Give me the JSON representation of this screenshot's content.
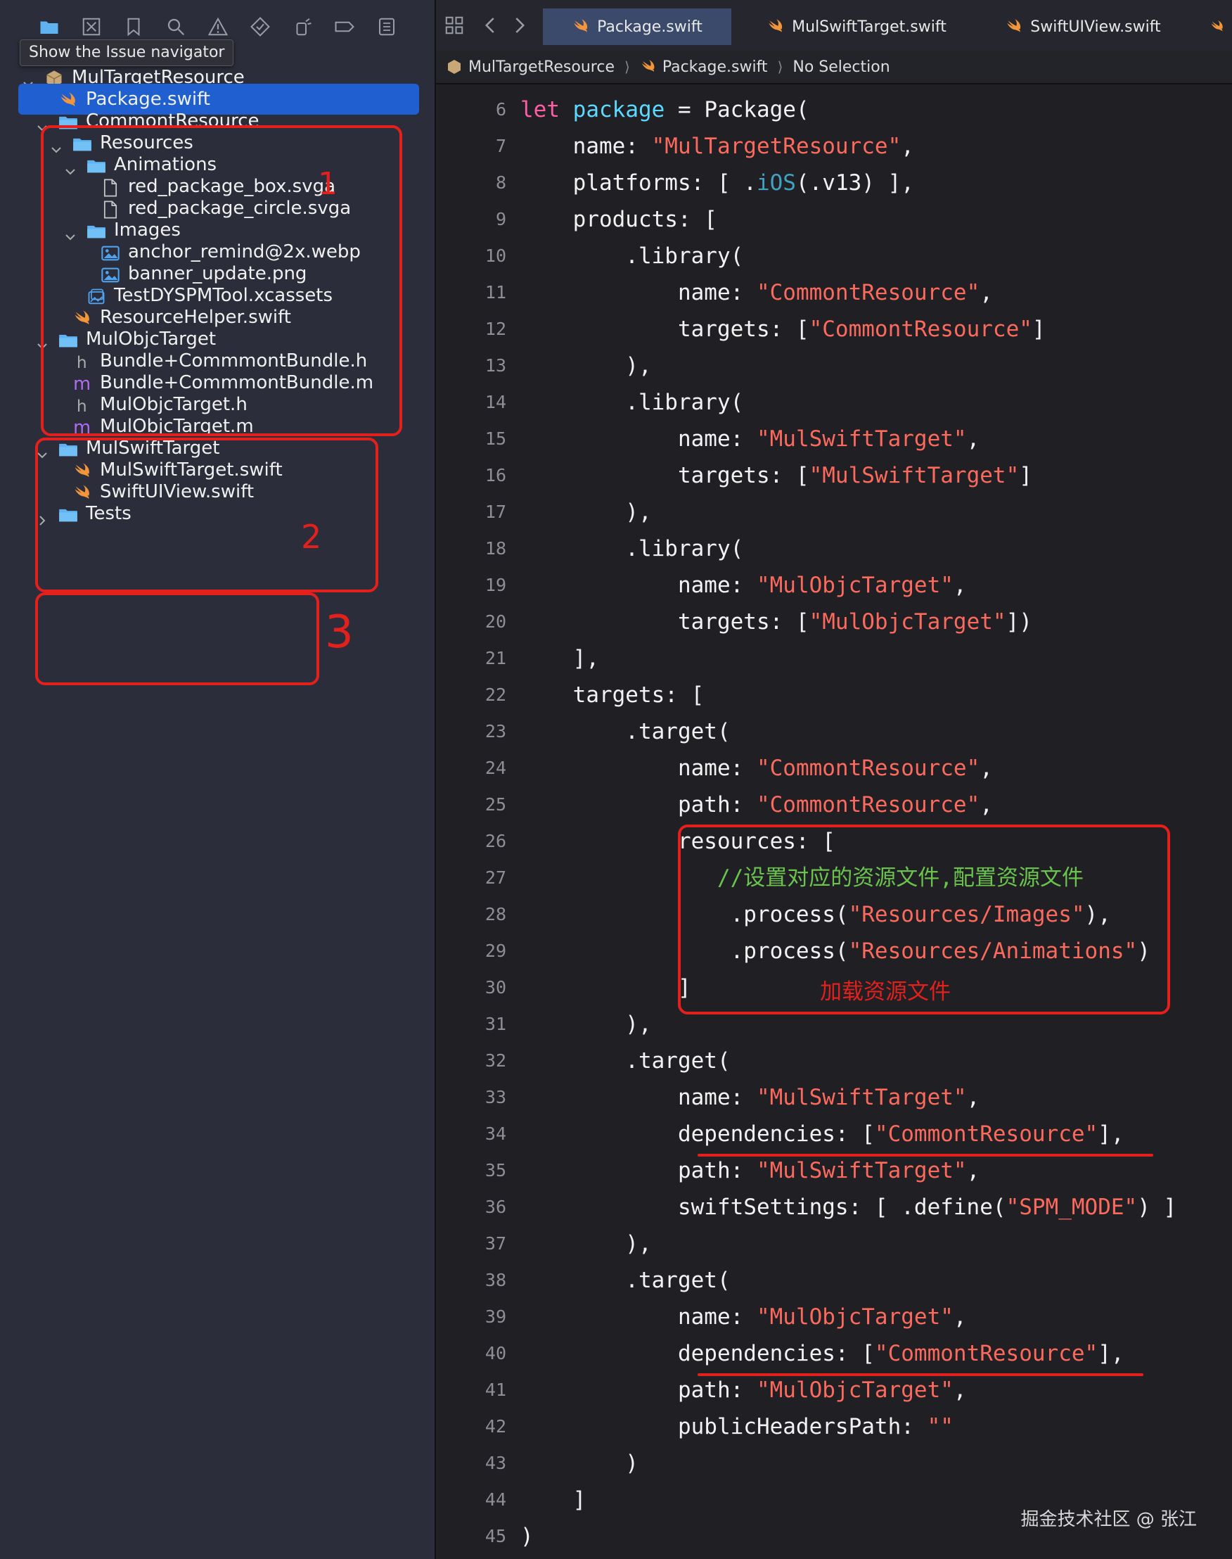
{
  "navigator": {
    "tooltip": "Show the Issue navigator",
    "toolbar_icons": [
      "folder-icon",
      "source-control-icon",
      "bookmark-icon",
      "search-icon",
      "warning-icon",
      "test-icon",
      "debug-icon",
      "breakpoint-icon",
      "report-icon"
    ],
    "tree": [
      {
        "label": "MulTargetResource",
        "kind": "package",
        "depth": 0,
        "disclosure": "open"
      },
      {
        "label": "Package.swift",
        "kind": "swift",
        "depth": 1,
        "selected": true
      },
      {
        "label": "CommontResource",
        "kind": "folder",
        "depth": 1,
        "disclosure": "open"
      },
      {
        "label": "Resources",
        "kind": "folder",
        "depth": 2,
        "disclosure": "open"
      },
      {
        "label": "Animations",
        "kind": "folder",
        "depth": 3,
        "disclosure": "open"
      },
      {
        "label": "red_package_box.svga",
        "kind": "file",
        "depth": 4
      },
      {
        "label": "red_package_circle.svga",
        "kind": "file",
        "depth": 4
      },
      {
        "label": "Images",
        "kind": "folder",
        "depth": 3,
        "disclosure": "open"
      },
      {
        "label": "anchor_remind@2x.webp",
        "kind": "image",
        "depth": 4
      },
      {
        "label": "banner_update.png",
        "kind": "image",
        "depth": 4
      },
      {
        "label": "TestDYSPMTool.xcassets",
        "kind": "assets",
        "depth": 3
      },
      {
        "label": "ResourceHelper.swift",
        "kind": "swift",
        "depth": 2
      },
      {
        "label": "MulObjcTarget",
        "kind": "folder",
        "depth": 1,
        "disclosure": "open"
      },
      {
        "label": "Bundle+CommmontBundle.h",
        "kind": "h",
        "depth": 2
      },
      {
        "label": "Bundle+CommmontBundle.m",
        "kind": "m",
        "depth": 2
      },
      {
        "label": "MulObjcTarget.h",
        "kind": "h",
        "depth": 2
      },
      {
        "label": "MulObjcTarget.m",
        "kind": "m",
        "depth": 2
      },
      {
        "label": "MulSwiftTarget",
        "kind": "folder",
        "depth": 1,
        "disclosure": "open"
      },
      {
        "label": "MulSwiftTarget.swift",
        "kind": "swift",
        "depth": 2
      },
      {
        "label": "SwiftUIView.swift",
        "kind": "swift",
        "depth": 2
      },
      {
        "label": "Tests",
        "kind": "folder",
        "depth": 1,
        "disclosure": "closed"
      }
    ],
    "annotations": [
      "1",
      "2",
      "3"
    ]
  },
  "editor": {
    "tabs": [
      {
        "label": "Package.swift",
        "active": true
      },
      {
        "label": "MulSwiftTarget.swift",
        "active": false
      },
      {
        "label": "SwiftUIView.swift",
        "active": false
      }
    ],
    "breadcrumb": [
      "MulTargetResource",
      "Package.swift",
      "No Selection"
    ],
    "lines": [
      {
        "n": "6",
        "tokens": [
          [
            "kw",
            "let"
          ],
          [
            "p",
            " "
          ],
          [
            "ty",
            "package"
          ],
          [
            "p",
            " = Package("
          ]
        ]
      },
      {
        "n": "7",
        "tokens": [
          [
            "p",
            "    name: "
          ],
          [
            "st",
            "\"MulTargetResource\""
          ],
          [
            "p",
            ","
          ]
        ]
      },
      {
        "n": "8",
        "tokens": [
          [
            "p",
            "    platforms: [ ."
          ],
          [
            "fn",
            "iOS"
          ],
          [
            "p",
            "(.v13) ],"
          ]
        ]
      },
      {
        "n": "9",
        "tokens": [
          [
            "p",
            "    products: ["
          ]
        ]
      },
      {
        "n": "10",
        "tokens": [
          [
            "p",
            "        .library("
          ]
        ]
      },
      {
        "n": "11",
        "tokens": [
          [
            "p",
            "            name: "
          ],
          [
            "st",
            "\"CommontResource\""
          ],
          [
            "p",
            ","
          ]
        ]
      },
      {
        "n": "12",
        "tokens": [
          [
            "p",
            "            targets: ["
          ],
          [
            "st",
            "\"CommontResource\""
          ],
          [
            "p",
            "]"
          ]
        ]
      },
      {
        "n": "13",
        "tokens": [
          [
            "p",
            "        ),"
          ]
        ]
      },
      {
        "n": "14",
        "tokens": [
          [
            "p",
            "        .library("
          ]
        ]
      },
      {
        "n": "15",
        "tokens": [
          [
            "p",
            "            name: "
          ],
          [
            "st",
            "\"MulSwiftTarget\""
          ],
          [
            "p",
            ","
          ]
        ]
      },
      {
        "n": "16",
        "tokens": [
          [
            "p",
            "            targets: ["
          ],
          [
            "st",
            "\"MulSwiftTarget\""
          ],
          [
            "p",
            "]"
          ]
        ]
      },
      {
        "n": "17",
        "tokens": [
          [
            "p",
            "        ),"
          ]
        ]
      },
      {
        "n": "18",
        "tokens": [
          [
            "p",
            "        .library("
          ]
        ]
      },
      {
        "n": "19",
        "tokens": [
          [
            "p",
            "            name: "
          ],
          [
            "st",
            "\"MulObjcTarget\""
          ],
          [
            "p",
            ","
          ]
        ]
      },
      {
        "n": "20",
        "tokens": [
          [
            "p",
            "            targets: ["
          ],
          [
            "st",
            "\"MulObjcTarget\""
          ],
          [
            "p",
            "])"
          ]
        ]
      },
      {
        "n": "21",
        "tokens": [
          [
            "p",
            "    ],"
          ]
        ]
      },
      {
        "n": "22",
        "tokens": [
          [
            "p",
            "    targets: ["
          ]
        ]
      },
      {
        "n": "23",
        "tokens": [
          [
            "p",
            "        .target("
          ]
        ]
      },
      {
        "n": "24",
        "tokens": [
          [
            "p",
            "            name: "
          ],
          [
            "st",
            "\"CommontResource\""
          ],
          [
            "p",
            ","
          ]
        ]
      },
      {
        "n": "25",
        "tokens": [
          [
            "p",
            "            path: "
          ],
          [
            "st",
            "\"CommontResource\""
          ],
          [
            "p",
            ","
          ]
        ]
      },
      {
        "n": "26",
        "tokens": [
          [
            "p",
            "            resources: ["
          ]
        ]
      },
      {
        "n": "27",
        "tokens": [
          [
            "p",
            "               "
          ],
          [
            "cm",
            "//设置对应的资源文件,配置资源文件"
          ]
        ]
      },
      {
        "n": "28",
        "tokens": [
          [
            "p",
            "                .process("
          ],
          [
            "st",
            "\"Resources/Images\""
          ],
          [
            "p",
            "),"
          ]
        ]
      },
      {
        "n": "29",
        "tokens": [
          [
            "p",
            "                .process("
          ],
          [
            "st",
            "\"Resources/Animations\""
          ],
          [
            "p",
            ")"
          ]
        ]
      },
      {
        "n": "30",
        "tokens": [
          [
            "p",
            "            ]"
          ]
        ]
      },
      {
        "n": "31",
        "tokens": [
          [
            "p",
            "        ),"
          ]
        ]
      },
      {
        "n": "32",
        "tokens": [
          [
            "p",
            "        .target("
          ]
        ]
      },
      {
        "n": "33",
        "tokens": [
          [
            "p",
            "            name: "
          ],
          [
            "st",
            "\"MulSwiftTarget\""
          ],
          [
            "p",
            ","
          ]
        ]
      },
      {
        "n": "34",
        "tokens": [
          [
            "p",
            "            dependencies: ["
          ],
          [
            "st",
            "\"CommontResource\""
          ],
          [
            "p",
            "],"
          ]
        ]
      },
      {
        "n": "35",
        "tokens": [
          [
            "p",
            "            path: "
          ],
          [
            "st",
            "\"MulSwiftTarget\""
          ],
          [
            "p",
            ","
          ]
        ]
      },
      {
        "n": "36",
        "tokens": [
          [
            "p",
            "            swiftSettings: [ .define("
          ],
          [
            "st",
            "\"SPM_MODE\""
          ],
          [
            "p",
            ") ]"
          ]
        ]
      },
      {
        "n": "37",
        "tokens": [
          [
            "p",
            "        ),"
          ]
        ]
      },
      {
        "n": "38",
        "tokens": [
          [
            "p",
            "        .target("
          ]
        ]
      },
      {
        "n": "39",
        "tokens": [
          [
            "p",
            "            name: "
          ],
          [
            "st",
            "\"MulObjcTarget\""
          ],
          [
            "p",
            ","
          ]
        ]
      },
      {
        "n": "40",
        "tokens": [
          [
            "p",
            "            dependencies: ["
          ],
          [
            "st",
            "\"CommontResource\""
          ],
          [
            "p",
            "],"
          ]
        ]
      },
      {
        "n": "41",
        "tokens": [
          [
            "p",
            "            path: "
          ],
          [
            "st",
            "\"MulObjcTarget\""
          ],
          [
            "p",
            ","
          ]
        ]
      },
      {
        "n": "42",
        "tokens": [
          [
            "p",
            "            publicHeadersPath: "
          ],
          [
            "st",
            "\"\""
          ]
        ]
      },
      {
        "n": "43",
        "tokens": [
          [
            "p",
            "        )"
          ]
        ]
      },
      {
        "n": "44",
        "tokens": [
          [
            "p",
            "    ]"
          ]
        ]
      },
      {
        "n": "45",
        "tokens": [
          [
            "p",
            ")"
          ]
        ]
      }
    ],
    "annotation_label": "加载资源文件",
    "watermark": "掘金技术社区 @ 张江"
  },
  "colors": {
    "accent_selection": "#1f5fd0",
    "annotation_red": "#e3201c",
    "keyword": "#fc5fa3",
    "string": "#fc6a5d",
    "comment": "#6ac34d",
    "type": "#5dd8ff",
    "folder": "#5fb3f0",
    "swift": "#f3953a",
    "objc_m": "#b06cf0"
  }
}
